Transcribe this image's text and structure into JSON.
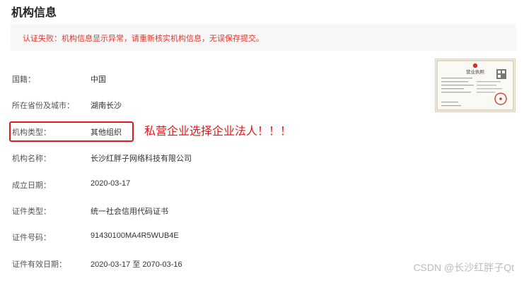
{
  "page": {
    "title": "机构信息"
  },
  "alert": {
    "text": "认证失败：机构信息显示异常，请重新核实机构信息，无误保存提交。",
    "color": "#e8352a"
  },
  "fields": [
    {
      "label": "国籍：",
      "value": "中国"
    },
    {
      "label": "所在省份及城市：",
      "value": "湖南长沙"
    },
    {
      "label": "机构类型：",
      "value": "其他组织"
    },
    {
      "label": "机构名称：",
      "value": "长沙红胖子网络科技有限公司"
    },
    {
      "label": "成立日期：",
      "value": "2020-03-17"
    },
    {
      "label": "证件类型：",
      "value": "统一社会信用代码证书"
    },
    {
      "label": "证件号码：",
      "value": "91430100MA4R5WUB4E"
    },
    {
      "label": "证件有效日期：",
      "value": "2020-03-17 至 2070-03-16"
    }
  ],
  "annotation": {
    "text": "私营企业选择企业法人！！！",
    "color": "#e01a1a"
  },
  "license_image": {
    "heading": "营业执照",
    "seal_color": "#d62f2f"
  },
  "watermark": {
    "text": "CSDN @长沙红胖子Qt"
  }
}
